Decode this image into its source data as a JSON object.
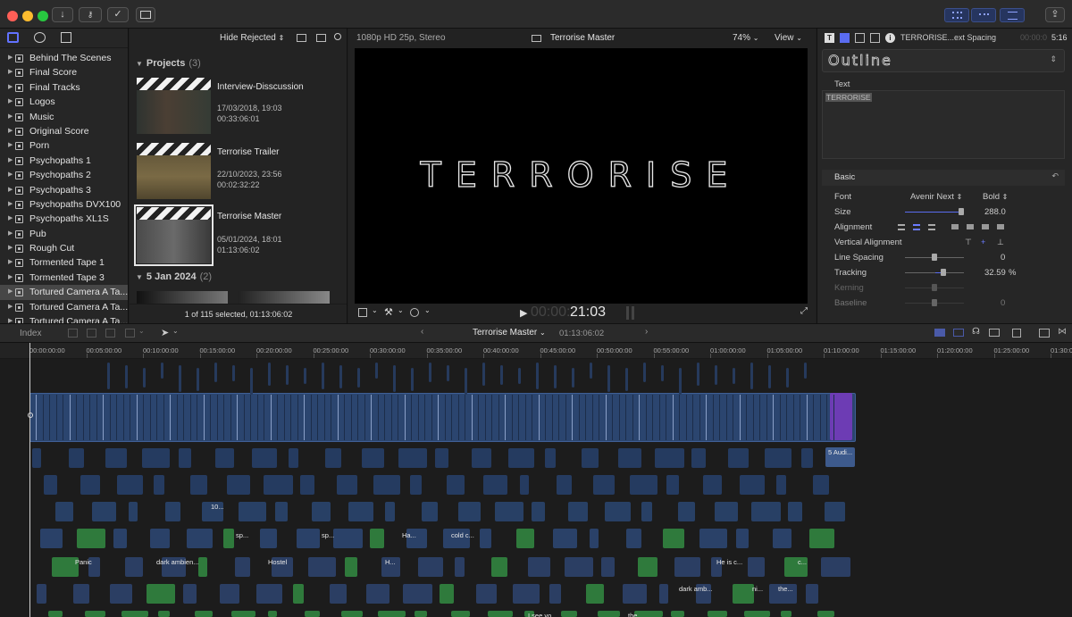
{
  "library": {
    "events": [
      "Behind The Scenes",
      "Final Score",
      "Final Tracks",
      "Logos",
      "Music",
      "Original Score",
      "Porn",
      "Psychopaths 1",
      "Psychopaths 2",
      "Psychopaths 3",
      "Psychopaths DVX100",
      "Psychopaths XL1S",
      "Pub",
      "Rough Cut",
      "Tormented Tape 1",
      "Tormented Tape 3",
      "Tortured Camera A Ta...",
      "Tortured Camera A Ta...",
      "Tortured Camera A Ta..."
    ],
    "selected_index": 16
  },
  "browser": {
    "filter": "Hide Rejected",
    "section_projects": "Projects",
    "section_projects_count": "(3)",
    "clips": [
      {
        "name": "Interview-Disscussion",
        "date": "17/03/2018, 19:03",
        "duration": "00:33:06:01"
      },
      {
        "name": "Terrorise Trailer",
        "date": "22/10/2023, 23:56",
        "duration": "00:02:32:22"
      },
      {
        "name": "Terrorise Master",
        "date": "05/01/2024, 18:01",
        "duration": "01:13:06:02"
      }
    ],
    "section_date": "5 Jan 2024",
    "section_date_count": "(2)",
    "footer": "1 of 115 selected, 01:13:06:02"
  },
  "viewer": {
    "format": "1080p HD 25p, Stereo",
    "project": "Terrorise Master",
    "zoom": "74%",
    "view": "View",
    "title_text": "TERRORISE",
    "timecode_dim": "00:00:",
    "timecode": "21:03"
  },
  "inspector": {
    "header": "TERRORISE...ext Spacing",
    "time_dim": "00:00:0",
    "time": "5:16",
    "preset": "Outline",
    "text_label": "Text",
    "text_value": "TERRORISE",
    "basic": "Basic",
    "font_label": "Font",
    "font": "Avenir Next",
    "weight": "Bold",
    "size_label": "Size",
    "size": "288.0",
    "alignment_label": "Alignment",
    "valign_label": "Vertical Alignment",
    "line_spacing_label": "Line Spacing",
    "line_spacing": "0",
    "tracking_label": "Tracking",
    "tracking": "32.59",
    "tracking_unit": "%",
    "kerning_label": "Kerning",
    "baseline_label": "Baseline",
    "baseline": "0"
  },
  "timeline": {
    "index": "Index",
    "project": "Terrorise Master",
    "duration": "01:13:06:02",
    "ruler": [
      "00:00:00:00",
      "00:05:00:00",
      "00:10:00:00",
      "00:15:00:00",
      "00:20:00:00",
      "00:25:00:00",
      "00:30:00:00",
      "00:35:00:00",
      "00:40:00:00",
      "00:45:00:00",
      "00:50:00:00",
      "00:55:00:00",
      "01:00:00:00",
      "01:05:00:00",
      "01:10:00:00",
      "01:15:00:00",
      "01:20:00:00",
      "01:25:00:00",
      "01:30:00:00"
    ],
    "clip_labels": [
      "Panic",
      "dark ambien...",
      "Hostel",
      "H...",
      "He is c...",
      "dark amb...",
      "the...",
      "Ha...",
      "cold c...",
      "sp...",
      "sp...",
      "10...",
      "5 Audi...",
      "I see yo...",
      "the...",
      "ni...",
      "c..."
    ]
  },
  "colors": {
    "accent": "#5a6cf0",
    "video_clip": "#2c4675",
    "audio_clip": "#2b3e63",
    "music_clip": "#2f7a3c",
    "title_clip": "#6d3cb4",
    "close": "#ff5f57",
    "minimize": "#febc2e",
    "zoom": "#28c840"
  }
}
